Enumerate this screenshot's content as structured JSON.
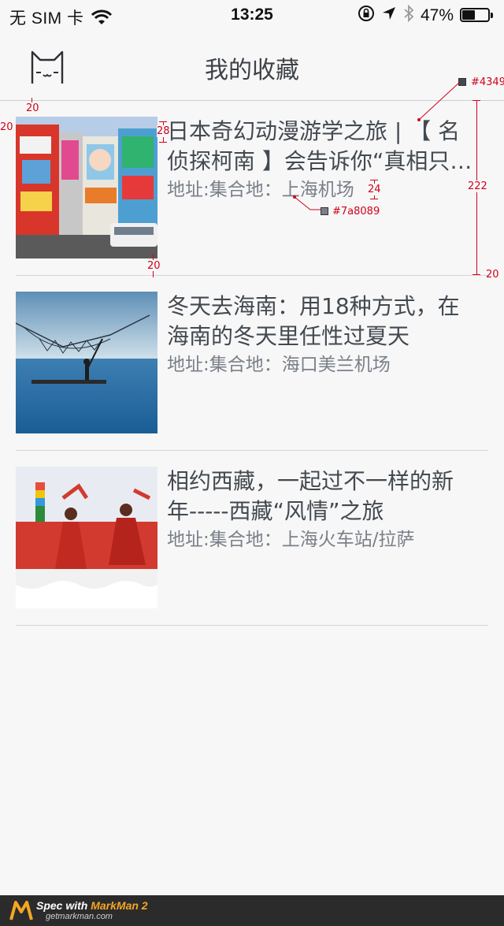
{
  "status_bar": {
    "carrier": "无 SIM 卡",
    "time": "13:25",
    "battery": "47%",
    "icons": [
      "wifi-icon",
      "rotation-lock-icon",
      "location-arrow-icon",
      "bluetooth-icon",
      "battery-icon"
    ]
  },
  "header": {
    "title": "我的收藏",
    "logo_icon": "cat-face-icon"
  },
  "favorites": [
    {
      "title": "日本奇幻动漫游学之旅 | 【 名侦探柯南 】会告诉你“真相只…",
      "address_label": "地址:",
      "address": "集合地：上海机场",
      "image": "akihabara-street-photo"
    },
    {
      "title": "冬天去海南：用18种方式，在海南的冬天里任性过夏天",
      "address_label": "地址:",
      "address": "集合地：海口美兰机场",
      "image": "fishing-net-sea-photo"
    },
    {
      "title": "相约西藏，一起过不一样的新年-----西藏“风情”之旅",
      "address_label": "地址:",
      "address": "集合地：上海火车站/拉萨",
      "image": "tibet-dancers-photo"
    }
  ],
  "spec_annotations": {
    "margin_top": "20",
    "margin_left": "20",
    "title_offset": "28",
    "line_gap": "24",
    "item_height": "222",
    "margin_bottom": "20",
    "margin_right": "20",
    "title_color": "#43495",
    "addr_color": "#7a8089"
  },
  "colors": {
    "title": "#434950",
    "address": "#7a8089",
    "background": "#f7f7f7",
    "divider": "#d6d6d6",
    "annotation": "#d0021b"
  },
  "footer": {
    "prefix": "Spec with ",
    "brand": "MarkMan 2",
    "url": "getmarkman.com"
  }
}
